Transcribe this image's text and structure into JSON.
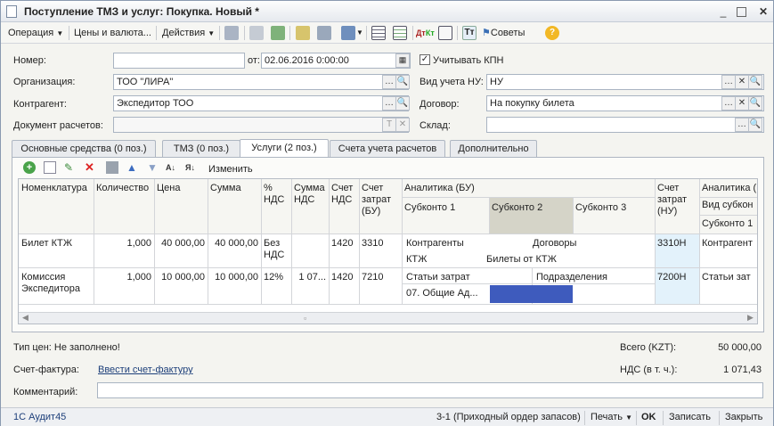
{
  "window": {
    "title": "Поступление ТМЗ и услуг: Покупка. Новый *"
  },
  "toolbar": {
    "operation": "Операция",
    "prices": "Цены и валюта...",
    "actions": "Действия",
    "advice": "Советы"
  },
  "form": {
    "number_label": "Номер:",
    "number_value": "",
    "date_label": "от:",
    "date_value": "02.06.2016  0:00:00",
    "kpn_label": "Учитывать КПН",
    "kpn_checked": true,
    "org_label": "Организация:",
    "org_value": "ТОО \"ЛИРА\"",
    "nu_label": "Вид учета НУ:",
    "nu_value": "НУ",
    "contractor_label": "Контрагент:",
    "contractor_value": "Экспедитор ТОО",
    "contract_label": "Договор:",
    "contract_value": "На покупку билета",
    "settlement_label": "Документ расчетов:",
    "settlement_value": "",
    "warehouse_label": "Склад:",
    "warehouse_value": ""
  },
  "tabs": [
    {
      "label": "Основные средства (0 поз.)"
    },
    {
      "label": "ТМЗ (0 поз.)"
    },
    {
      "label": "Услуги (2 поз.)"
    },
    {
      "label": "Счета учета расчетов"
    },
    {
      "label": "Дополнительно"
    }
  ],
  "services_toolbar": {
    "edit_label": "Изменить"
  },
  "table": {
    "headers": {
      "nomenclature": "Номенклатура",
      "quantity": "Количество",
      "price": "Цена",
      "sum": "Сумма",
      "vat_pct": "%\nНДС",
      "vat_sum": "Сумма\nНДС",
      "vat_account": "Счет\nНДС",
      "cost_account": "Счет\nзатрат\n(БУ)",
      "analytics_bu": "Аналитика (БУ)",
      "sub1": "Субконто 1",
      "sub2": "Субконто 2",
      "sub3": "Субконто 3",
      "cost_account_nu": "Счет\nзатрат\n(НУ)",
      "analytics_nu": "Аналитика (",
      "sub_type": "Вид субкон",
      "sub1_nu": "Субконто 1"
    },
    "rows": [
      {
        "nomenclature": "Билет КТЖ",
        "quantity": "1,000",
        "price": "40 000,00",
        "sum": "40 000,00",
        "vat_pct": "Без\nНДС",
        "vat_sum": "",
        "vat_account": "1420",
        "cost_account": "3310",
        "an1_type": "Контрагенты",
        "an2_type": "Договоры",
        "an1_value": "КТЖ",
        "an2_value": "Билеты от КТЖ",
        "cost_account_nu": "3310Н",
        "an_nu": "Контрагент"
      },
      {
        "nomenclature": "Комиссия\nЭкспедитора",
        "quantity": "1,000",
        "price": "10 000,00",
        "sum": "10 000,00",
        "vat_pct": "12%",
        "vat_sum": "1 07...",
        "vat_account": "1420",
        "cost_account": "7210",
        "an1_type": "Статьи затрат",
        "an2_type": "Подразделения",
        "an1_value": "07. Общие Ад...",
        "an2_value": "",
        "cost_account_nu": "7200Н",
        "an_nu": "Статьи зат"
      }
    ]
  },
  "footer": {
    "price_type": "Тип цен: Не заполнено!",
    "total_label": "Всего (KZT):",
    "total_value": "50 000,00",
    "invoice_label": "Счет-фактура:",
    "invoice_link": "Ввести счет-фактуру",
    "vat_label": "НДС (в т. ч.):",
    "vat_value": "1 071,43",
    "comment_label": "Комментарий:",
    "comment_value": ""
  },
  "statusbar": {
    "app": "1С Аудит45",
    "print_form": "3-1 (Приходный ордер запасов)",
    "print": "Печать",
    "ok": "OK",
    "save": "Записать",
    "close": "Закрыть"
  }
}
